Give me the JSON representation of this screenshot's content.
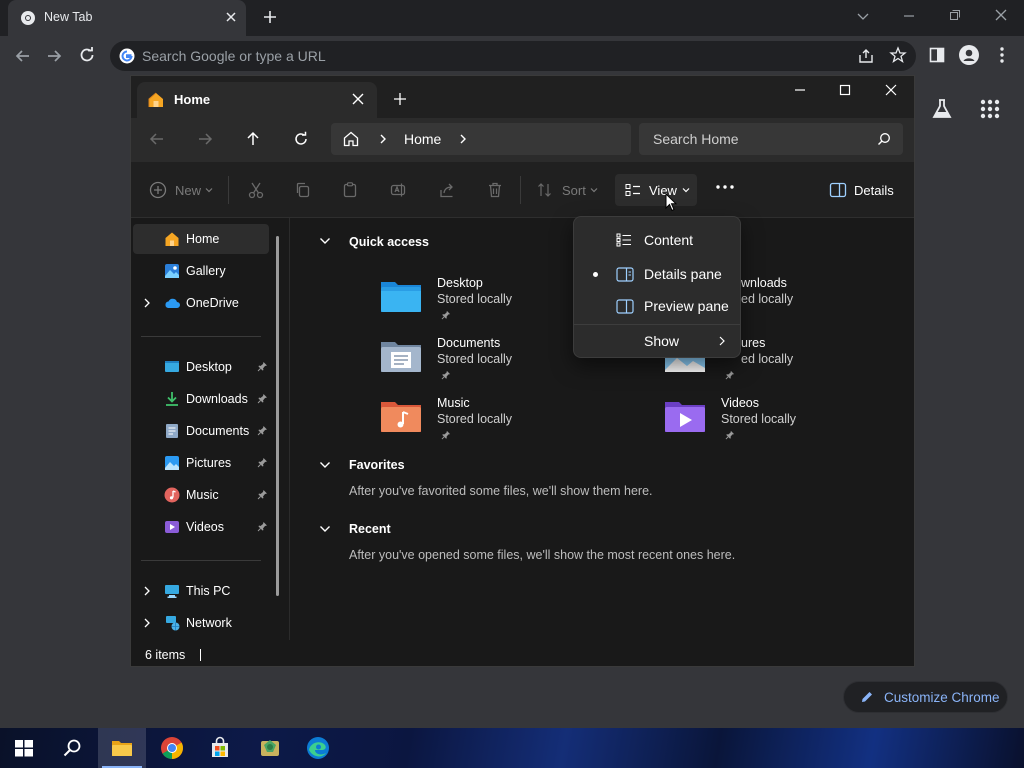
{
  "chrome": {
    "tab_title": "New Tab",
    "omnibox_placeholder": "Search Google or type a URL",
    "customize_label": "Customize Chrome"
  },
  "explorer": {
    "tab_title": "Home",
    "breadcrumb": [
      "Home"
    ],
    "search_placeholder": "Search Home",
    "commands": {
      "new": "New",
      "sort": "Sort",
      "view": "View",
      "details": "Details"
    },
    "sidebar": {
      "top": [
        "Home",
        "Gallery",
        "OneDrive"
      ],
      "pinned": [
        "Desktop",
        "Downloads",
        "Documents",
        "Pictures",
        "Music",
        "Videos"
      ],
      "bottom": [
        "This PC",
        "Network"
      ]
    },
    "sections": {
      "quick_access": "Quick access",
      "favorites": "Favorites",
      "favorites_msg": "After you've favorited some files, we'll show them here.",
      "recent": "Recent",
      "recent_msg": "After you've opened some files, we'll show the most recent ones here."
    },
    "quick_access_items": [
      {
        "name": "Desktop",
        "sub": "Stored locally"
      },
      {
        "name": "Downloads",
        "sub": "Stored locally"
      },
      {
        "name": "Documents",
        "sub": "Stored locally"
      },
      {
        "name": "Pictures",
        "sub": "Stored locally"
      },
      {
        "name": "Music",
        "sub": "Stored locally"
      },
      {
        "name": "Videos",
        "sub": "Stored locally"
      }
    ],
    "qa_partial": {
      "downloads_name": "wnloads",
      "downloads_sub": "ed locally",
      "pictures_name": "ures",
      "pictures_sub": "ed locally"
    },
    "status": "6 items",
    "view_menu": {
      "content": "Content",
      "details_pane": "Details pane",
      "preview_pane": "Preview pane",
      "show": "Show"
    }
  }
}
